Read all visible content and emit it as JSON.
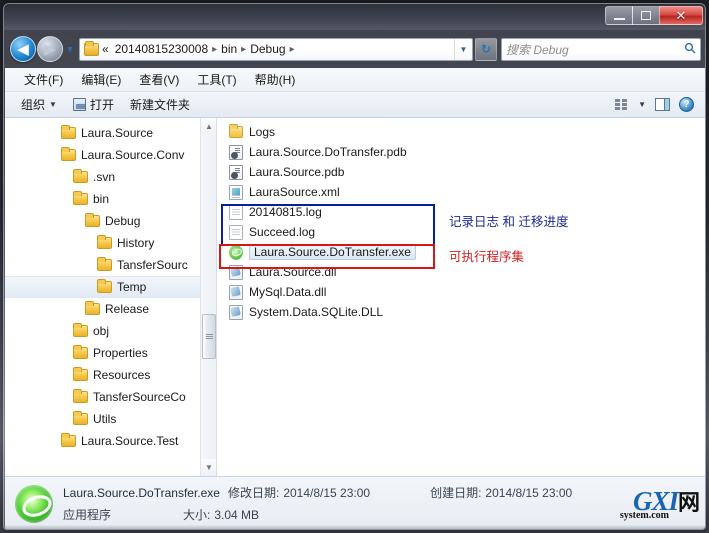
{
  "window": {
    "caption_buttons": [
      {
        "name": "minimize",
        "glyph": "—"
      },
      {
        "name": "maximize",
        "glyph": "▢"
      },
      {
        "name": "close",
        "glyph": "✕"
      }
    ]
  },
  "navbar": {
    "back_glyph": "◀",
    "forward_glyph": "▶",
    "history_glyph": "▼",
    "breadcrumbs": [
      "«",
      "20140815230008",
      "bin",
      "Debug"
    ],
    "separator": "▸",
    "dropdown_glyph": "▼",
    "refresh_glyph": "↻"
  },
  "search": {
    "placeholder": "搜索 Debug",
    "icon": "search-icon",
    "icon_glyph": "🔍"
  },
  "menu": {
    "items": [
      "文件(F)",
      "编辑(E)",
      "查看(V)",
      "工具(T)",
      "帮助(H)"
    ]
  },
  "toolbar": {
    "organize_label": "组织",
    "organize_caret": "▼",
    "open_label": "打开",
    "new_folder_label": "新建文件夹",
    "view_caret": "▼"
  },
  "navpane": {
    "items": [
      {
        "label": "Laura.Source",
        "indent": 0,
        "selected": false
      },
      {
        "label": "Laura.Source.Conv",
        "indent": 0,
        "selected": false
      },
      {
        "label": ".svn",
        "indent": 1,
        "selected": false
      },
      {
        "label": "bin",
        "indent": 1,
        "selected": false
      },
      {
        "label": "Debug",
        "indent": 2,
        "selected": false
      },
      {
        "label": "History",
        "indent": 3,
        "selected": false
      },
      {
        "label": "TansferSourc",
        "indent": 3,
        "selected": false
      },
      {
        "label": "Temp",
        "indent": 3,
        "selected": true
      },
      {
        "label": "Release",
        "indent": 2,
        "selected": false
      },
      {
        "label": "obj",
        "indent": 1,
        "selected": false
      },
      {
        "label": "Properties",
        "indent": 1,
        "selected": false
      },
      {
        "label": "Resources",
        "indent": 1,
        "selected": false
      },
      {
        "label": "TansferSourceCo",
        "indent": 1,
        "selected": false
      },
      {
        "label": "Utils",
        "indent": 1,
        "selected": false
      },
      {
        "label": "Laura.Source.Test",
        "indent": 0,
        "selected": false
      }
    ],
    "scroll_up_glyph": "▲",
    "scroll_down_glyph": "▼"
  },
  "files": [
    {
      "name": "Logs",
      "icon": "folder-icon",
      "type": "folder",
      "selected": false
    },
    {
      "name": "Laura.Source.DoTransfer.pdb",
      "icon": "pdb-file-icon",
      "type": "pdb",
      "selected": false
    },
    {
      "name": "Laura.Source.pdb",
      "icon": "pdb-file-icon",
      "type": "pdb",
      "selected": false
    },
    {
      "name": "LauraSource.xml",
      "icon": "xml-file-icon",
      "type": "xml",
      "selected": false
    },
    {
      "name": "20140815.log",
      "icon": "log-file-icon",
      "type": "doc",
      "selected": false
    },
    {
      "name": "Succeed.log",
      "icon": "log-file-icon",
      "type": "doc",
      "selected": false
    },
    {
      "name": "Laura.Source.DoTransfer.exe",
      "icon": "application-icon",
      "type": "exe",
      "selected": true
    },
    {
      "name": "Laura.Source.dll",
      "icon": "dll-file-icon",
      "type": "dll",
      "selected": false
    },
    {
      "name": "MySql.Data.dll",
      "icon": "dll-file-icon",
      "type": "dll",
      "selected": false
    },
    {
      "name": "System.Data.SQLite.DLL",
      "icon": "dll-file-icon",
      "type": "dll",
      "selected": false
    }
  ],
  "annotations": {
    "blue_text": "记录日志 和 迁移进度",
    "red_text": "可执行程序集",
    "blue_color": "#1b2a8c",
    "red_color": "#d02020"
  },
  "status": {
    "file_name": "Laura.Source.DoTransfer.exe",
    "modified_label": "修改日期:",
    "modified_value": "2014/8/15 23:00",
    "created_label": "创建日期:",
    "created_value": "2014/8/15 23:00",
    "file_type": "应用程序",
    "size_label": "大小:",
    "size_value": "3.04 MB"
  },
  "watermark": {
    "main": "GXI",
    "net": "网",
    "sub": "system.com"
  }
}
